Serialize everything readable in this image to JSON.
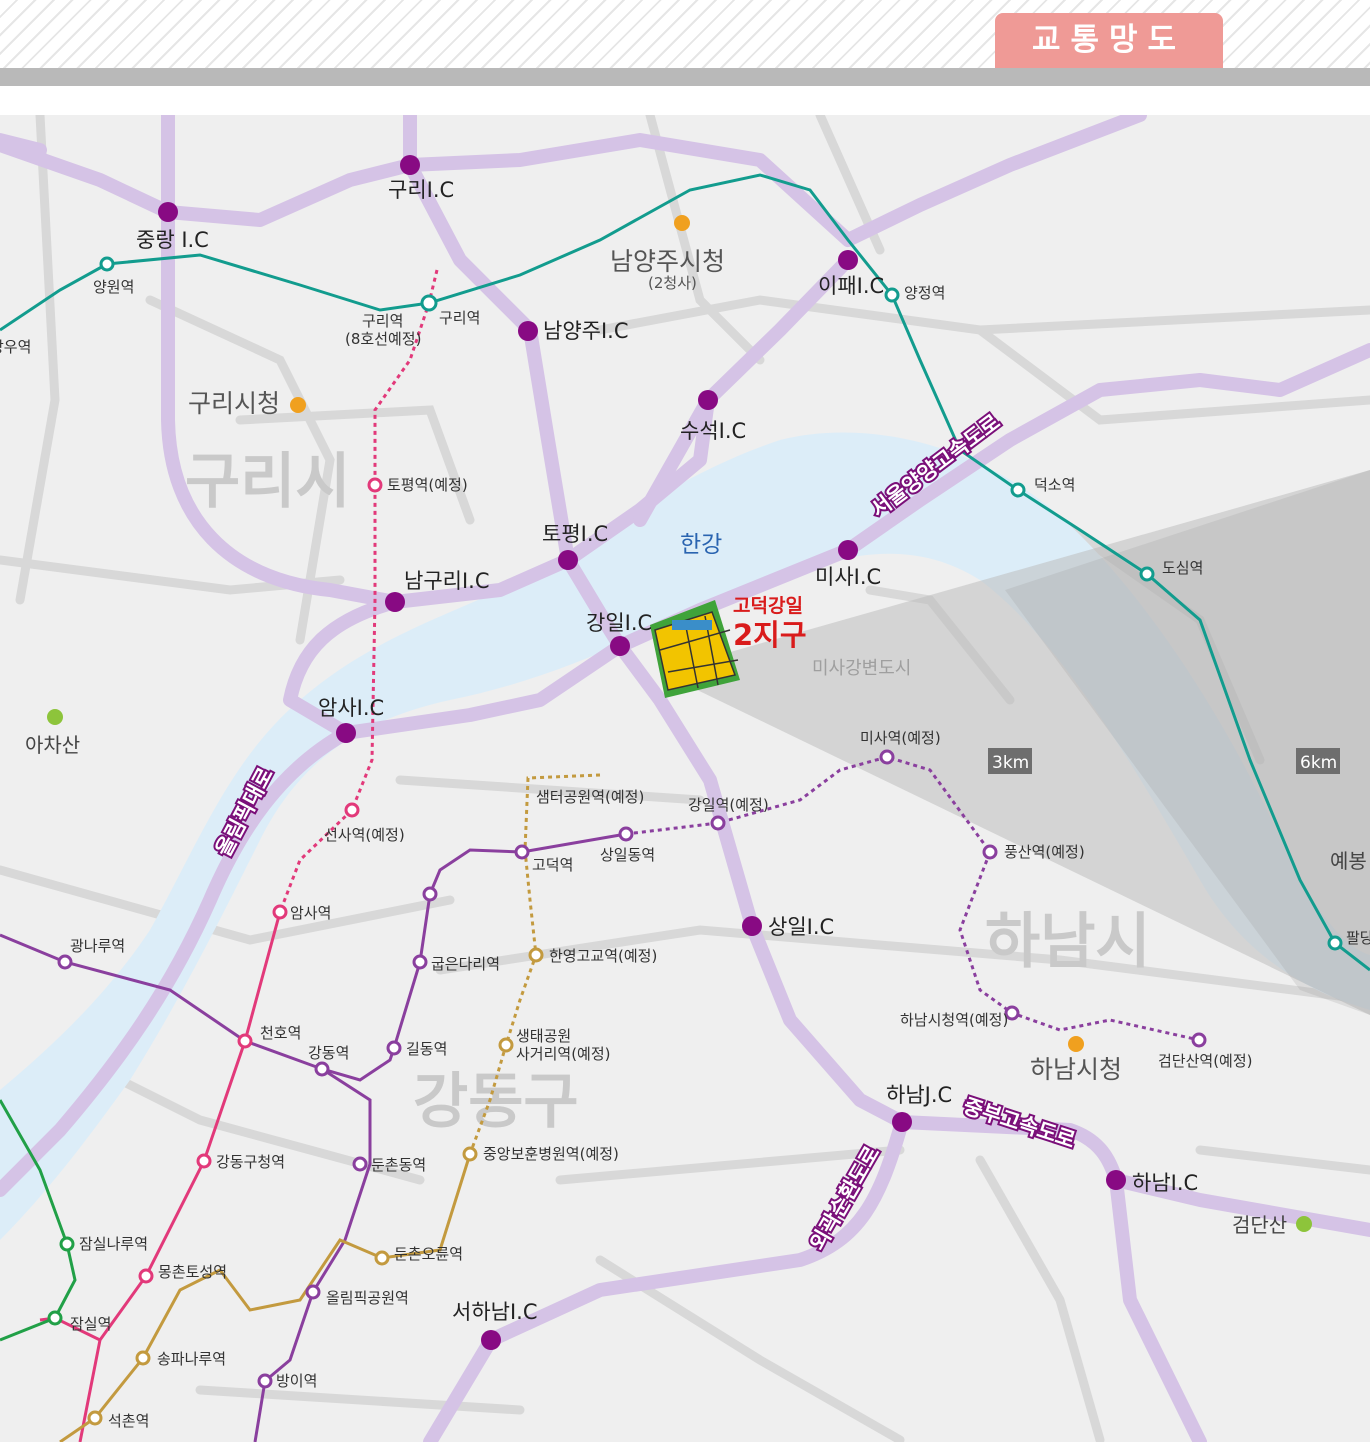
{
  "header": {
    "title": "교통망도"
  },
  "districts": {
    "guri": "구리시",
    "gangdong": "강동구",
    "hanam": "하남시"
  },
  "water": {
    "hangang": "한강"
  },
  "places": {
    "guri_city_hall": "구리시청",
    "namyangju_city_hall": "남양주시청",
    "namyangju_city_hall_sub": "(2청사)",
    "hanam_city_hall": "하남시청",
    "achasan": "아차산",
    "geomdansan": "검단산",
    "misa_riverside": "미사강변도시",
    "yebong": "예봉"
  },
  "project": {
    "line1": "고덕강일",
    "line2": "2지구"
  },
  "rings": {
    "r3": "3km",
    "r6": "6km"
  },
  "roads": {
    "seoul_yangyang": "서울양양고속도로",
    "olympic": "올림픽대로",
    "jungbu": "중부고속도로",
    "outer_ring": "외곽순환도로"
  },
  "interchanges": {
    "guri": "구리I.C",
    "jungnang": "중랑 I.C",
    "namyangju": "남양주I.C",
    "ipae": "이패I.C",
    "suseok": "수석I.C",
    "topyeong": "토평I.C",
    "namguri": "남구리I.C",
    "misa": "미사I.C",
    "gangil": "강일I.C",
    "amsa": "암사I.C",
    "sangil": "상일I.C",
    "hanam_jc": "하남J.C",
    "hanam": "하남I.C",
    "seohanam": "서하남I.C"
  },
  "stations": {
    "mangu": "망우역",
    "yangwon": "양원역",
    "guri": "구리역",
    "guri8_1": "구리역",
    "guri8_2": "(8호선예정)",
    "yangjeong": "양정역",
    "deokso": "덕소역",
    "dosim": "도심역",
    "paldang": "팔당",
    "topyeong_plan": "토평역(예정)",
    "sunsa_plan": "선사역(예정)",
    "amsa": "암사역",
    "cheonho": "천호역",
    "gangdong": "강동역",
    "gangdong_gu": "강동구청역",
    "mongchon": "몽촌토성역",
    "jamsilnaru": "잠실나루역",
    "jamsil": "잠실역",
    "gwangnaru": "광나루역",
    "godeok": "고덕역",
    "sangil": "상일동역",
    "gangil_plan": "강일역(예정)",
    "misa_plan": "미사역(예정)",
    "pungsan_plan": "풍산역(예정)",
    "hanam_cityhall_plan": "하남시청역(예정)",
    "geomdansan_plan": "검단산역(예정)",
    "gubeundari": "굽은다리역",
    "gildong": "길동역",
    "dunchondong": "둔촌동역",
    "olympic_park": "올림픽공원역",
    "bangi": "방이역",
    "semteo_plan": "샘터공원역(예정)",
    "hanyeong_plan": "한영고교역(예정)",
    "saengtae_1": "생태공원",
    "saengtae_2": "사거리역(예정)",
    "jungang_plan": "중앙보훈병원역(예정)",
    "dunchon_oryun": "둔촌오륜역",
    "songpanaru": "송파나루역",
    "seokchon": "석촌역"
  },
  "colors": {
    "highway": "#d5c3e6",
    "interchange": "#880a83",
    "gyeongui_line": "#129c8e",
    "line5": "#8a3f9e",
    "line8": "#e2397a",
    "line9": "#c39a3f",
    "line2": "#21a047",
    "water": "#dcedf8",
    "buffer": "#cdcdcd",
    "header_tab": "#ef9a96"
  }
}
